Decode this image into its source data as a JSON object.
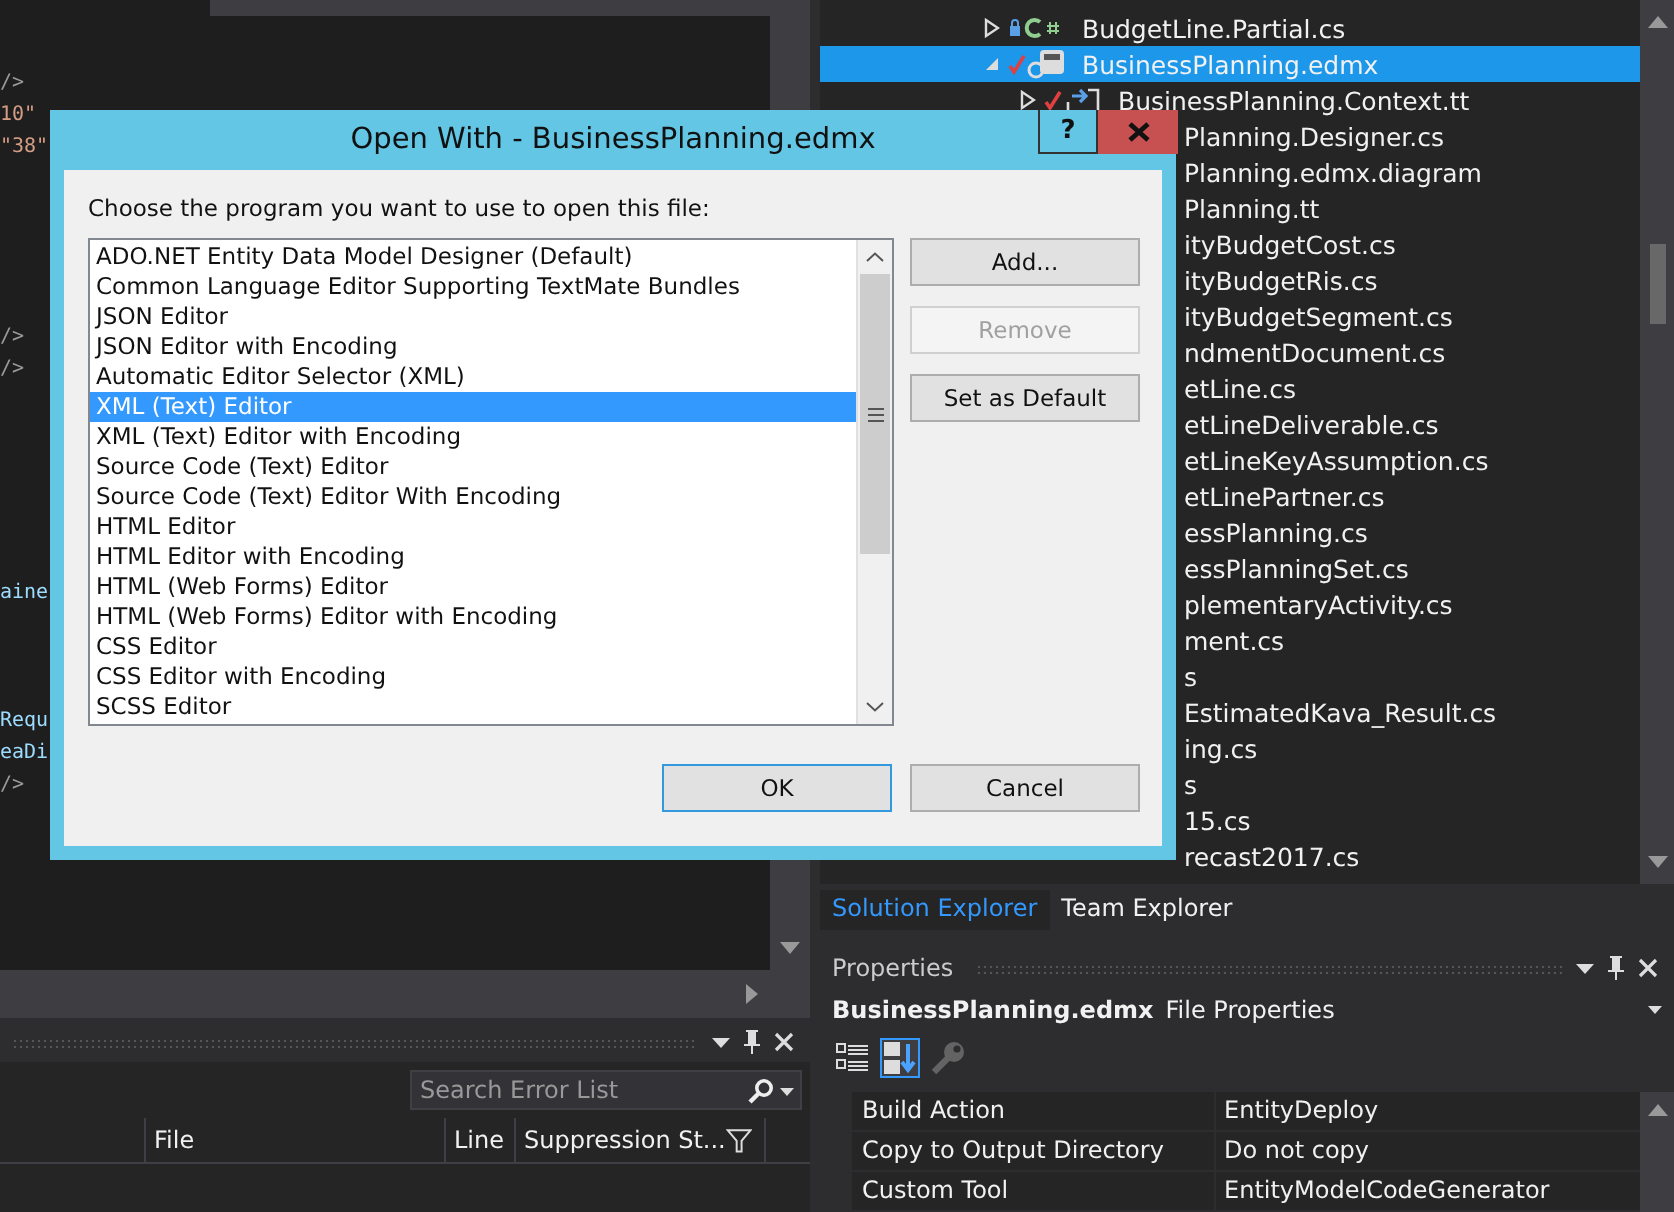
{
  "editor": {
    "code_blocks": [
      [
        "/>",
        "10\"",
        "\"38\""
      ],
      [
        "/>",
        "/>"
      ],
      [
        "aine"
      ],
      [
        "Requ",
        "eaDi",
        "/>"
      ]
    ]
  },
  "error_list": {
    "search": {
      "placeholder": "Search Error List"
    },
    "columns": [
      "File",
      "Line",
      "Suppression St..."
    ]
  },
  "solution_explorer": {
    "items": [
      {
        "label": "BudgetLine.Partial.cs",
        "kind": "csharp",
        "expanded": false,
        "selected": false
      },
      {
        "label": "BusinessPlanning.edmx",
        "kind": "model",
        "expanded": true,
        "selected": true,
        "children": [
          {
            "label": "BusinessPlanning.Context.tt",
            "kind": "template",
            "expanded": false,
            "selected": false
          },
          {
            "label": "Planning.Designer.cs",
            "selected": false
          },
          {
            "label": "Planning.edmx.diagram",
            "selected": false
          },
          {
            "label": "Planning.tt",
            "selected": false
          },
          {
            "label": "ityBudgetCost.cs",
            "selected": false
          },
          {
            "label": "ityBudgetRis.cs",
            "selected": false
          },
          {
            "label": "ityBudgetSegment.cs",
            "selected": false
          },
          {
            "label": "ndmentDocument.cs",
            "selected": false
          },
          {
            "label": "etLine.cs",
            "selected": false
          },
          {
            "label": "etLineDeliverable.cs",
            "selected": false
          },
          {
            "label": "etLineKeyAssumption.cs",
            "selected": false
          },
          {
            "label": "etLinePartner.cs",
            "selected": false
          },
          {
            "label": "essPlanning.cs",
            "selected": false
          },
          {
            "label": "essPlanningSet.cs",
            "selected": false
          },
          {
            "label": "plementaryActivity.cs",
            "selected": false
          },
          {
            "label": "ment.cs",
            "selected": false
          },
          {
            "label": "s",
            "selected": false
          },
          {
            "label": "EstimatedKava_Result.cs",
            "selected": false
          },
          {
            "label": "ing.cs",
            "selected": false
          },
          {
            "label": "s",
            "selected": false
          },
          {
            "label": "15.cs",
            "selected": false
          },
          {
            "label": "recast2017.cs",
            "selected": false
          }
        ]
      }
    ]
  },
  "panel_tabs": [
    {
      "label": "Solution Explorer",
      "selected": true
    },
    {
      "label": "Team Explorer",
      "selected": false
    }
  ],
  "properties": {
    "title": "Properties",
    "object_name": "BusinessPlanning.edmx",
    "object_type": "File Properties",
    "toolbar": [
      {
        "kind": "categorized",
        "selected": false,
        "disabled": false
      },
      {
        "kind": "alphabetical",
        "selected": true,
        "disabled": false
      },
      {
        "kind": "property-pages",
        "selected": false,
        "disabled": true
      }
    ],
    "rows": [
      {
        "name": "Build Action",
        "value": "EntityDeploy"
      },
      {
        "name": "Copy to Output Directory",
        "value": "Do not copy"
      },
      {
        "name": "Custom Tool",
        "value": "EntityModelCodeGenerator"
      }
    ]
  },
  "dialog": {
    "title": "Open With - BusinessPlanning.edmx",
    "help": "?",
    "prompt": "Choose the program you want to use to open this file:",
    "programs": [
      {
        "label": "ADO.NET Entity Data Model Designer (Default)",
        "selected": false
      },
      {
        "label": "Common Language Editor Supporting TextMate Bundles",
        "selected": false
      },
      {
        "label": "JSON Editor",
        "selected": false
      },
      {
        "label": "JSON Editor with Encoding",
        "selected": false
      },
      {
        "label": "Automatic Editor Selector (XML)",
        "selected": false
      },
      {
        "label": "XML (Text) Editor",
        "selected": true
      },
      {
        "label": "XML (Text) Editor with Encoding",
        "selected": false
      },
      {
        "label": "Source Code (Text) Editor",
        "selected": false
      },
      {
        "label": "Source Code (Text) Editor With Encoding",
        "selected": false
      },
      {
        "label": "HTML Editor",
        "selected": false
      },
      {
        "label": "HTML Editor with Encoding",
        "selected": false
      },
      {
        "label": "HTML (Web Forms) Editor",
        "selected": false
      },
      {
        "label": "HTML (Web Forms) Editor with Encoding",
        "selected": false
      },
      {
        "label": "CSS Editor",
        "selected": false
      },
      {
        "label": "CSS Editor with Encoding",
        "selected": false
      },
      {
        "label": "SCSS Editor",
        "selected": false
      }
    ],
    "side_buttons": [
      {
        "label": "Add...",
        "disabled": false
      },
      {
        "label": "Remove",
        "disabled": true
      },
      {
        "label": "Set as Default",
        "disabled": false
      }
    ],
    "footer_buttons": [
      {
        "label": "OK",
        "default": true
      },
      {
        "label": "Cancel",
        "default": false
      }
    ]
  }
}
